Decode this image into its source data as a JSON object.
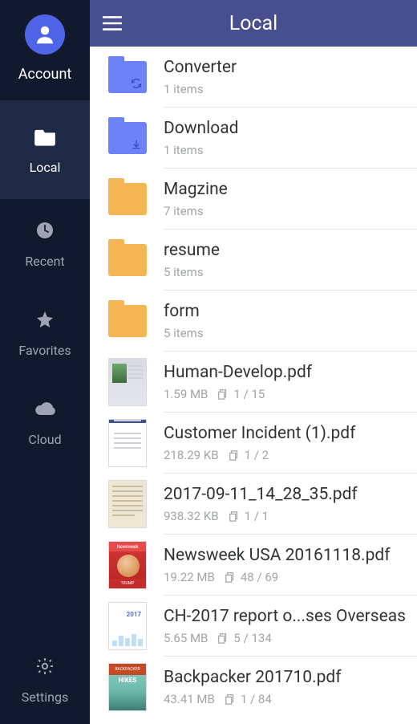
{
  "sidebar": {
    "account": {
      "label": "Account"
    },
    "items": [
      {
        "label": "Local",
        "icon": "folder-icon",
        "active": true
      },
      {
        "label": "Recent",
        "icon": "clock-icon",
        "active": false
      },
      {
        "label": "Favorites",
        "icon": "star-icon",
        "active": false
      },
      {
        "label": "Cloud",
        "icon": "cloud-icon",
        "active": false
      }
    ],
    "settings": {
      "label": "Settings",
      "icon": "gear-icon"
    }
  },
  "header": {
    "title": "Local",
    "menu_icon": "menu-icon"
  },
  "list": [
    {
      "kind": "folder",
      "name": "Converter",
      "meta": "1 items",
      "color": "blue",
      "badge": "sync"
    },
    {
      "kind": "folder",
      "name": "Download",
      "meta": "1 items",
      "color": "blue",
      "badge": "download"
    },
    {
      "kind": "folder",
      "name": "Magzine",
      "meta": "7 items",
      "color": "gold"
    },
    {
      "kind": "folder",
      "name": "resume",
      "meta": "5 items",
      "color": "gold"
    },
    {
      "kind": "folder",
      "name": "form",
      "meta": "5 items",
      "color": "gold"
    },
    {
      "kind": "file",
      "name": "Human-Develop.pdf",
      "size": "1.59 MB",
      "pages": "1 / 15",
      "thumb": "photo"
    },
    {
      "kind": "file",
      "name": "Customer Incident (1).pdf",
      "size": "218.29 KB",
      "pages": "1 / 2",
      "thumb": "textbar"
    },
    {
      "kind": "file",
      "name": "2017-09-11_14_28_35.pdf",
      "size": "938.32 KB",
      "pages": "1 / 1",
      "thumb": "scan"
    },
    {
      "kind": "file",
      "name": "Newsweek USA 20161118.pdf",
      "size": "19.22 MB",
      "pages": "48 / 69",
      "thumb": "newsweek"
    },
    {
      "kind": "file",
      "name": "CH-2017 report o...ses Overseas",
      "size": "5.65 MB",
      "pages": "5 / 134",
      "thumb": "ch2017"
    },
    {
      "kind": "file",
      "name": "Backpacker 201710.pdf",
      "size": "43.41 MB",
      "pages": "1 / 84",
      "thumb": "hike"
    }
  ]
}
